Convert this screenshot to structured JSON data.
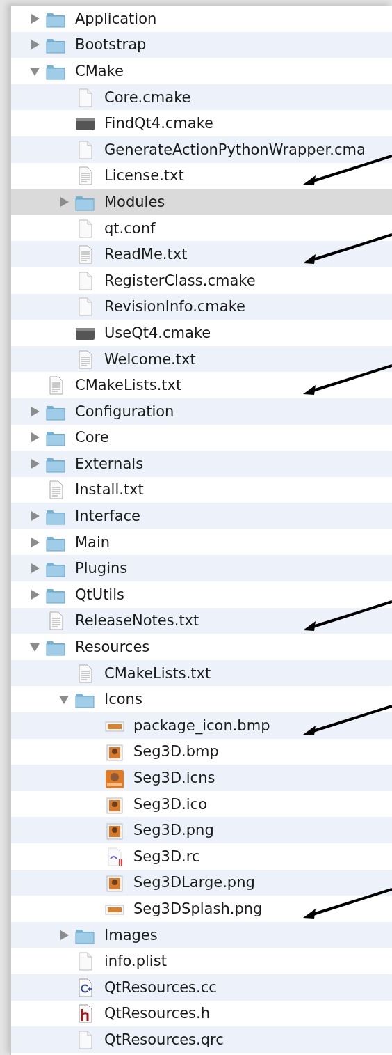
{
  "items": [
    {
      "name": "Application",
      "kind": "folder",
      "expanded": false,
      "selected": false,
      "pointer": false
    },
    {
      "name": "Bootstrap",
      "kind": "folder",
      "expanded": false,
      "selected": false,
      "pointer": false
    },
    {
      "name": "CMake",
      "kind": "folder",
      "expanded": true,
      "selected": false,
      "pointer": false,
      "children": [
        {
          "name": "Core.cmake",
          "kind": "file",
          "selected": false,
          "pointer": false
        },
        {
          "name": "FindQt4.cmake",
          "kind": "unix",
          "selected": false,
          "pointer": false
        },
        {
          "name": "GenerateActionPythonWrapper.cma",
          "kind": "file",
          "selected": false,
          "pointer": false
        },
        {
          "name": "License.txt",
          "kind": "text",
          "selected": false,
          "pointer": true
        },
        {
          "name": "Modules",
          "kind": "folder",
          "expanded": false,
          "selected": true,
          "pointer": false
        },
        {
          "name": "qt.conf",
          "kind": "file",
          "selected": false,
          "pointer": false
        },
        {
          "name": "ReadMe.txt",
          "kind": "text",
          "selected": false,
          "pointer": true
        },
        {
          "name": "RegisterClass.cmake",
          "kind": "file",
          "selected": false,
          "pointer": false
        },
        {
          "name": "RevisionInfo.cmake",
          "kind": "file",
          "selected": false,
          "pointer": false
        },
        {
          "name": "UseQt4.cmake",
          "kind": "unix",
          "selected": false,
          "pointer": false
        },
        {
          "name": "Welcome.txt",
          "kind": "text",
          "selected": false,
          "pointer": false
        }
      ]
    },
    {
      "name": "CMakeLists.txt",
      "kind": "text",
      "selected": false,
      "pointer": true
    },
    {
      "name": "Configuration",
      "kind": "folder",
      "expanded": false,
      "selected": false,
      "pointer": false
    },
    {
      "name": "Core",
      "kind": "folder",
      "expanded": false,
      "selected": false,
      "pointer": false
    },
    {
      "name": "Externals",
      "kind": "folder",
      "expanded": false,
      "selected": false,
      "pointer": false
    },
    {
      "name": "Install.txt",
      "kind": "text",
      "selected": false,
      "pointer": false
    },
    {
      "name": "Interface",
      "kind": "folder",
      "expanded": false,
      "selected": false,
      "pointer": false
    },
    {
      "name": "Main",
      "kind": "folder",
      "expanded": false,
      "selected": false,
      "pointer": false
    },
    {
      "name": "Plugins",
      "kind": "folder",
      "expanded": false,
      "selected": false,
      "pointer": false
    },
    {
      "name": "QtUtils",
      "kind": "folder",
      "expanded": false,
      "selected": false,
      "pointer": false
    },
    {
      "name": "ReleaseNotes.txt",
      "kind": "text",
      "selected": false,
      "pointer": true
    },
    {
      "name": "Resources",
      "kind": "folder",
      "expanded": true,
      "selected": false,
      "pointer": false,
      "children": [
        {
          "name": "CMakeLists.txt",
          "kind": "text",
          "selected": false,
          "pointer": false
        },
        {
          "name": "Icons",
          "kind": "folder",
          "expanded": true,
          "selected": false,
          "pointer": false,
          "children": [
            {
              "name": "package_icon.bmp",
              "kind": "banner",
              "selected": false,
              "pointer": true
            },
            {
              "name": "Seg3D.bmp",
              "kind": "image",
              "selected": false,
              "pointer": false
            },
            {
              "name": "Seg3D.icns",
              "kind": "app-icon",
              "selected": false,
              "pointer": false
            },
            {
              "name": "Seg3D.ico",
              "kind": "image",
              "selected": false,
              "pointer": false
            },
            {
              "name": "Seg3D.png",
              "kind": "image",
              "selected": false,
              "pointer": false
            },
            {
              "name": "Seg3D.rc",
              "kind": "resource",
              "selected": false,
              "pointer": false
            },
            {
              "name": "Seg3DLarge.png",
              "kind": "image",
              "selected": false,
              "pointer": false
            },
            {
              "name": "Seg3DSplash.png",
              "kind": "banner",
              "selected": false,
              "pointer": true
            }
          ]
        },
        {
          "name": "Images",
          "kind": "folder",
          "expanded": false,
          "selected": false,
          "pointer": false
        },
        {
          "name": "info.plist",
          "kind": "file",
          "selected": false,
          "pointer": false
        },
        {
          "name": "QtResources.cc",
          "kind": "cpp-source",
          "selected": false,
          "pointer": false
        },
        {
          "name": "QtResources.h",
          "kind": "header",
          "selected": false,
          "pointer": false
        },
        {
          "name": "QtResources.qrc",
          "kind": "file",
          "selected": false,
          "pointer": false
        }
      ]
    }
  ]
}
